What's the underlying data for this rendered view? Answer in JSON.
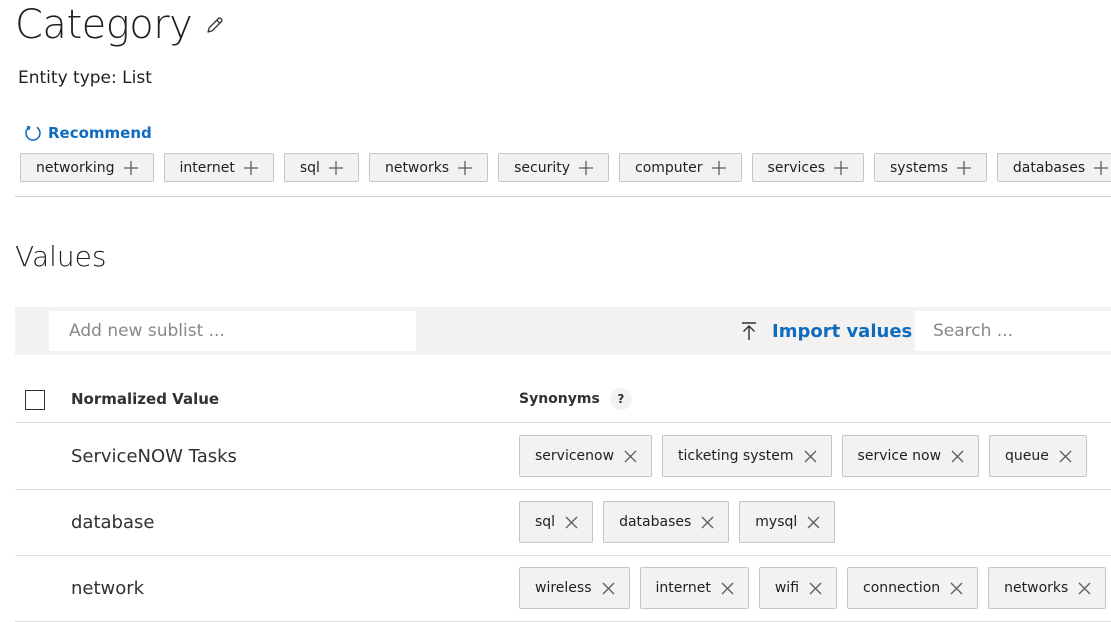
{
  "header": {
    "title": "Category",
    "entity_type": "Entity type: List"
  },
  "recommend": {
    "label": "Recommend",
    "items": [
      "networking",
      "internet",
      "sql",
      "networks",
      "security",
      "computer",
      "services",
      "systems",
      "databases"
    ]
  },
  "values_section": {
    "title": "Values",
    "sublist_placeholder": "Add new sublist ...",
    "import_label": "Import values",
    "search_placeholder": "Search ..."
  },
  "table": {
    "col_normalized": "Normalized Value",
    "col_synonyms": "Synonyms",
    "help_symbol": "?",
    "rows": [
      {
        "name": "ServiceNOW Tasks",
        "synonyms": [
          "servicenow",
          "ticketing system",
          "service now",
          "queue"
        ]
      },
      {
        "name": "database",
        "synonyms": [
          "sql",
          "databases",
          "mysql"
        ]
      },
      {
        "name": "network",
        "synonyms": [
          "wireless",
          "internet",
          "wifi",
          "connection",
          "networks"
        ]
      }
    ]
  },
  "colors": {
    "accent": "#0f6cbd",
    "chip_bg": "#f3f2f1",
    "toolbar_bg": "#f3f2f1"
  }
}
